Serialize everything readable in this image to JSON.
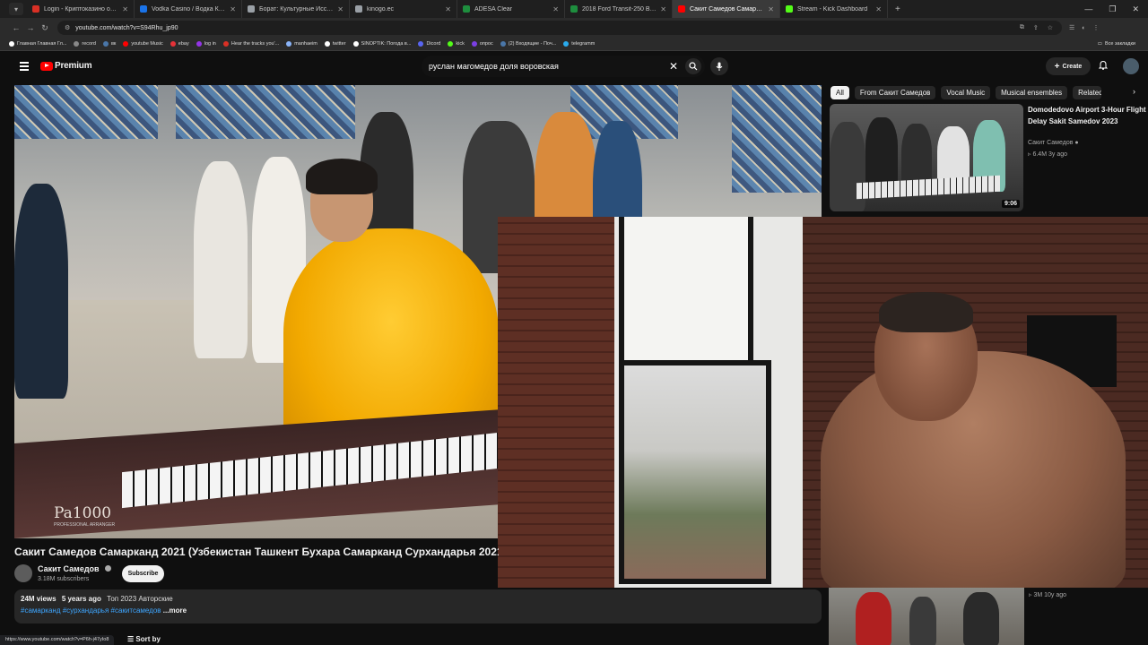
{
  "browser": {
    "tabs": [
      {
        "label": "Login - Криптоказино онлайн",
        "color": "#d93025",
        "active": false
      },
      {
        "label": "Vodka Casino / Водка Казино",
        "color": "#1a73e8",
        "active": false
      },
      {
        "label": "Борат: Культурные Исследо",
        "color": "#9aa0a6",
        "active": false
      },
      {
        "label": "kinogo.ec",
        "color": "#9aa0a6",
        "active": false
      },
      {
        "label": "ADESA Clear",
        "color": "#1e8e3e",
        "active": false
      },
      {
        "label": "2018 Ford Transit-250 Base w/",
        "color": "#1e8e3e",
        "active": false
      },
      {
        "label": "Сакит Самедов Самарканд",
        "color": "#ff0000",
        "active": true
      },
      {
        "label": "Stream - Kick Dashboard",
        "color": "#53fc18",
        "active": false
      }
    ],
    "url": "youtube.com/watch?v=S94Rhu_jp90",
    "bookmarks": [
      {
        "label": "Главная Главная Гл...",
        "color": "#ffffff"
      },
      {
        "label": "record",
        "color": "#888888"
      },
      {
        "label": "вк",
        "color": "#4a76a8"
      },
      {
        "label": "youtube Music",
        "color": "#ff0000"
      },
      {
        "label": "ebay",
        "color": "#e53238"
      },
      {
        "label": "log in",
        "color": "#9334e6"
      },
      {
        "label": "Hear the tracks you'...",
        "color": "#d93025"
      },
      {
        "label": "manhaeim",
        "color": "#8ab4f8"
      },
      {
        "label": "twitter",
        "color": "#ffffff"
      },
      {
        "label": "SINOPTIK: Погода в...",
        "color": "#ffffff"
      },
      {
        "label": "Dicord",
        "color": "#5865f2"
      },
      {
        "label": "kick",
        "color": "#53fc18"
      },
      {
        "label": "опрос",
        "color": "#7b3fe4"
      },
      {
        "label": "(2) Входящие - Поч...",
        "color": "#4a76a8"
      },
      {
        "label": "telegramm",
        "color": "#2aabee"
      }
    ],
    "bookmarks_all": "Все закладки"
  },
  "youtube": {
    "logo_text": "Premium",
    "search_query": "руслан магомедов доля воровская",
    "create_label": "Create",
    "video": {
      "title": "Сакит Самедов Самарканд 2021 (Узбекистан Ташкент Бухара Самарканд Сурхандарья 2021",
      "keyboard_label": "Pa1000",
      "keyboard_sub": "PROFESSIONAL ARRANGER",
      "channel": "Сакит Самедов",
      "subscribers": "3.18M subscribers",
      "subscribe_label": "Subscribe",
      "views": "24M views",
      "age": "5 years ago",
      "desc_line": "Топ 2023 Авторские",
      "tags": "#самарканд #сурхандарья #сакитсамедов",
      "more": "...more"
    },
    "chips": [
      "All",
      "From Сакит Самедов",
      "Vocal Music",
      "Musical ensembles",
      "Related"
    ],
    "recommendations": [
      {
        "title": "Domodedovo Airport 3-Hour Flight Delay Sakit Samedov 2023",
        "channel": "Сакит Самедов",
        "meta": "6.4M  3y ago",
        "duration": "9:06"
      },
      {
        "meta": "3M  10y ago"
      }
    ],
    "sort_by": "Sort by",
    "status_url": "https://www.youtube.com/watch?v=P6h-j47yIo8"
  }
}
